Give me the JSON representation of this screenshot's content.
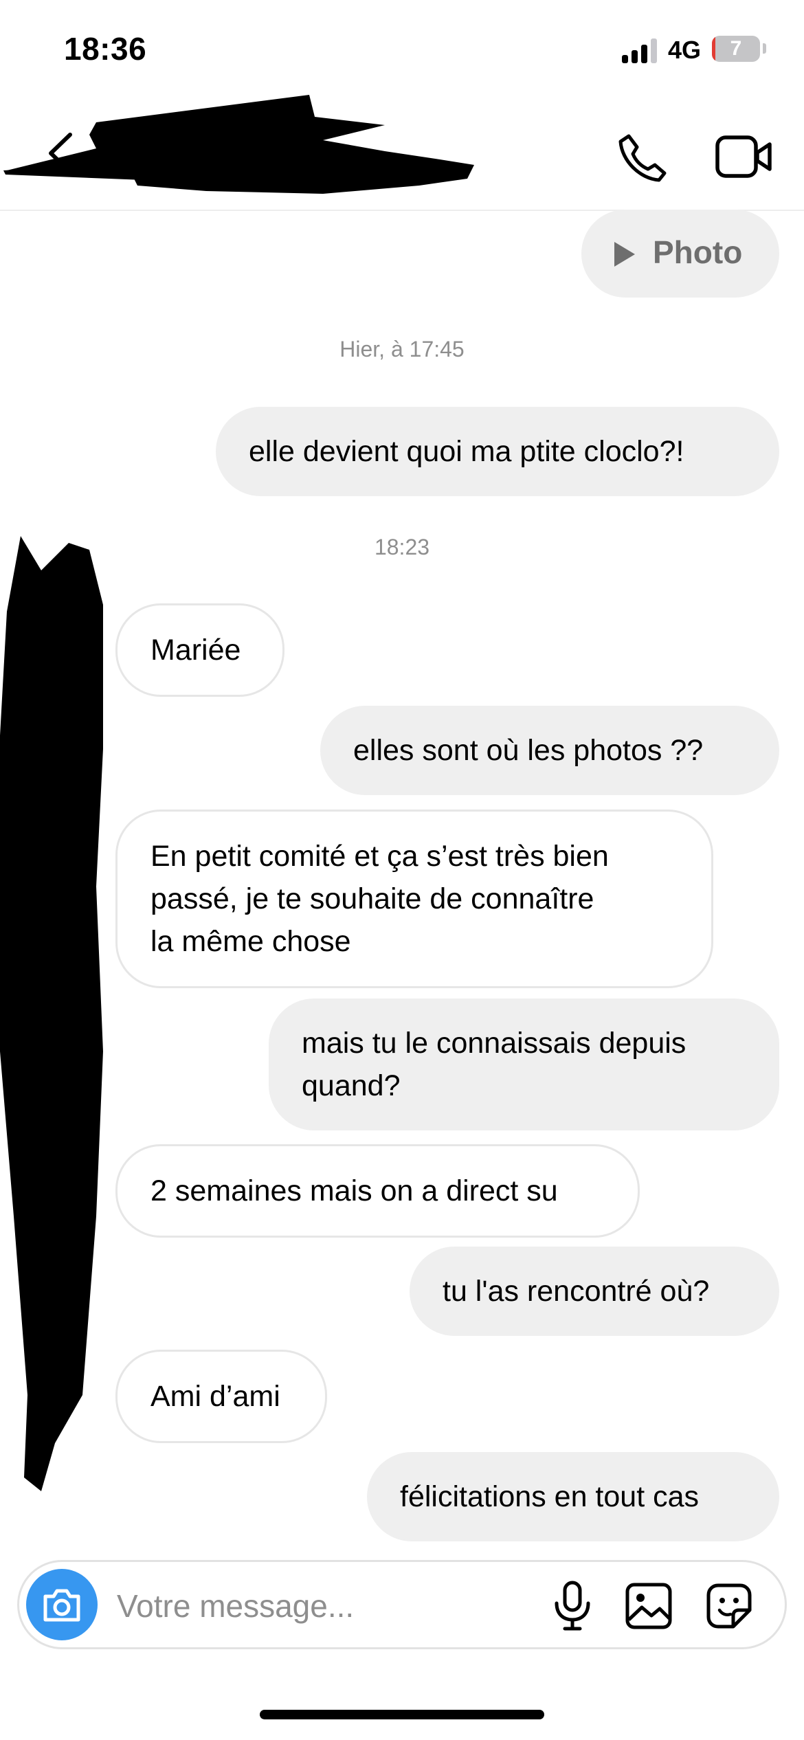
{
  "status_bar": {
    "time": "18:36",
    "network": "4G",
    "battery": "7",
    "battery_level": 0.07
  },
  "header": {
    "back_icon": "chevron-left-icon",
    "call_icon": "phone-icon",
    "video_icon": "video-camera-icon"
  },
  "thread": {
    "photo_label": "Photo",
    "timestamps": [
      "Hier, à 17:45",
      "18:23"
    ],
    "messages": [
      {
        "from": "me",
        "text": "elle devient quoi ma ptite cloclo?!"
      },
      {
        "from": "them",
        "text": "Mariée"
      },
      {
        "from": "me",
        "text": "elles sont où les photos ??"
      },
      {
        "from": "them",
        "text": "En petit comité et ça s’est très bien\npassé, je te souhaite de connaître\nla même chose"
      },
      {
        "from": "me",
        "text": "mais tu le connaissais depuis\nquand?"
      },
      {
        "from": "them",
        "text": "2 semaines mais on a direct su"
      },
      {
        "from": "me",
        "text": "tu l'as rencontré où?"
      },
      {
        "from": "them",
        "text": "Ami d’ami"
      },
      {
        "from": "me",
        "text": "félicitations en tout cas"
      }
    ]
  },
  "composer": {
    "placeholder": "Votre message...",
    "icons": [
      "camera-icon",
      "microphone-icon",
      "gallery-icon",
      "sticker-icon"
    ],
    "accent_color": "#3797f0"
  },
  "colors": {
    "sent_bubble": "#efefef",
    "received_border": "#e6e6e6",
    "timestamp": "#8e8e8e"
  }
}
